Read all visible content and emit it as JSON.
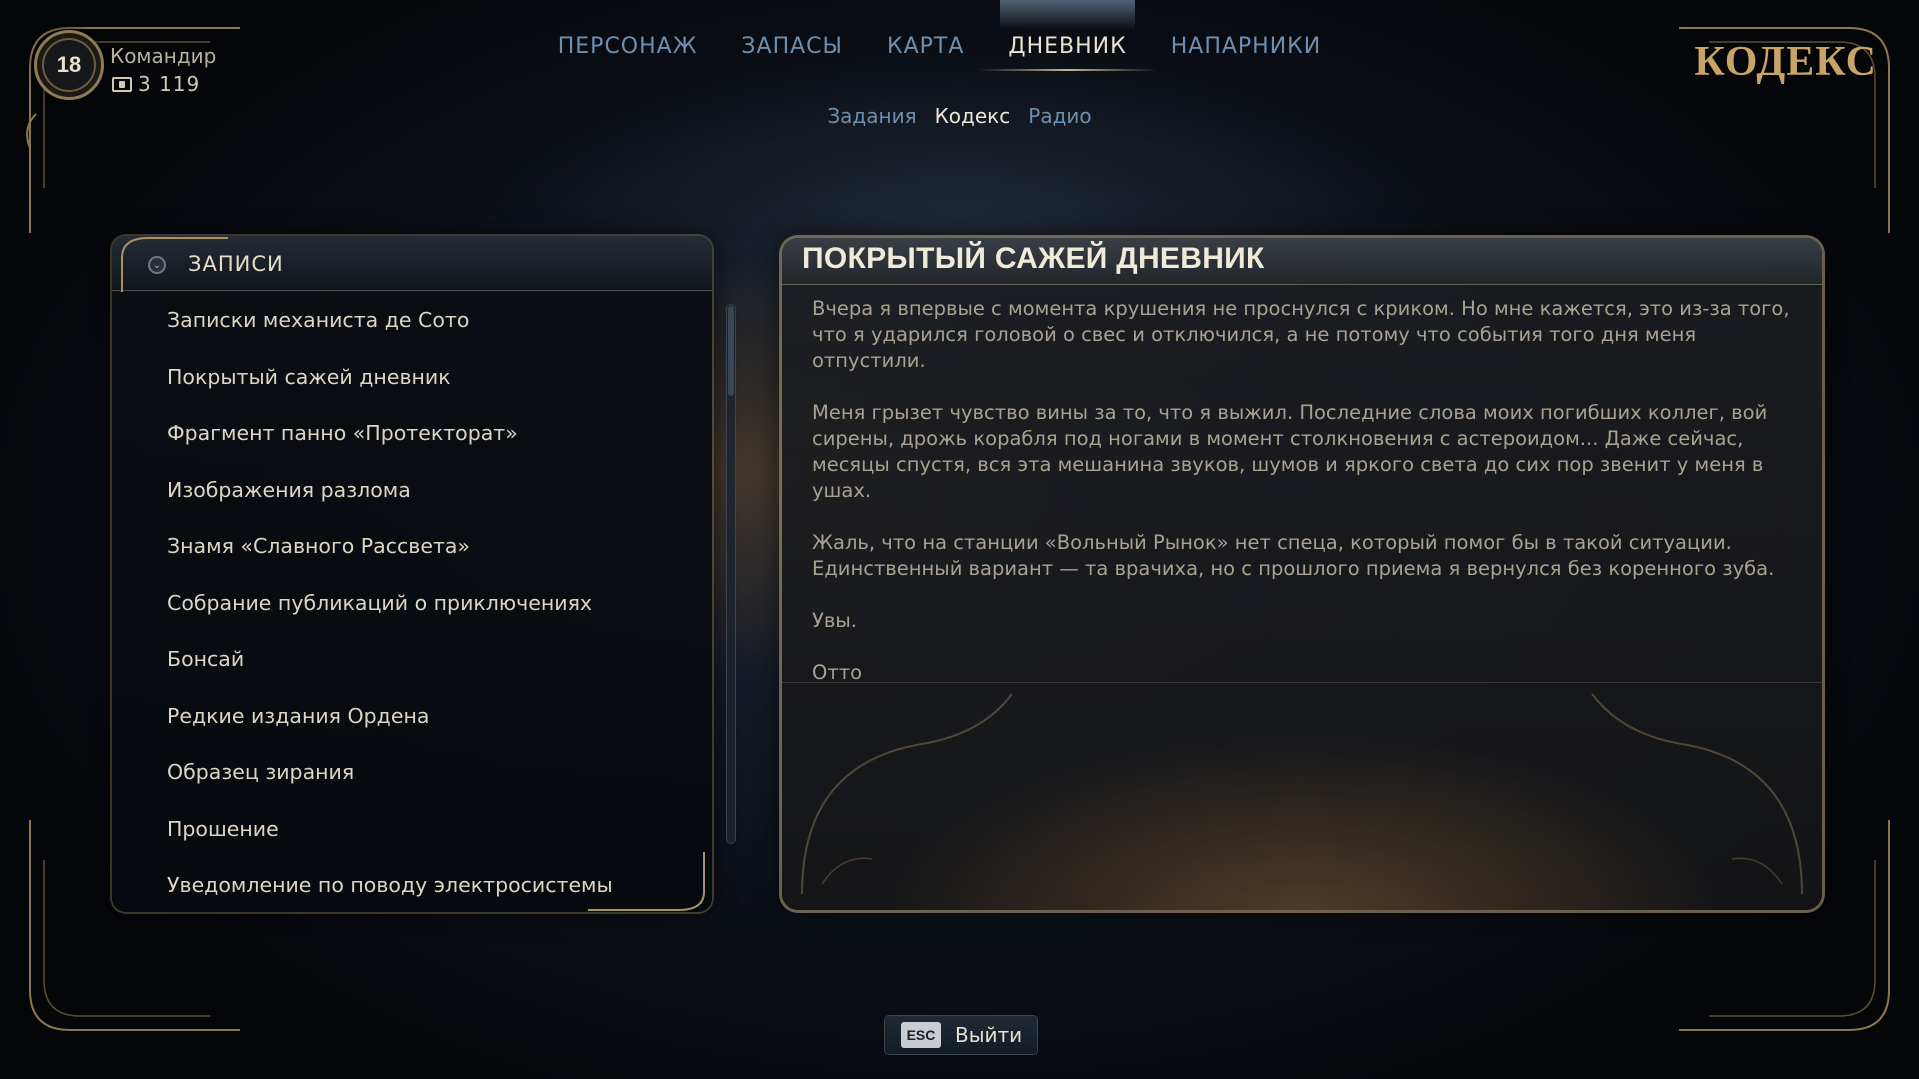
{
  "player": {
    "level": "18",
    "name": "Командир",
    "currency": "3 119"
  },
  "nav": {
    "tabs": [
      {
        "label": "ПЕРСОНАЖ"
      },
      {
        "label": "ЗАПАСЫ"
      },
      {
        "label": "КАРТА"
      },
      {
        "label": "ДНЕВНИК"
      },
      {
        "label": "НАПАРНИКИ"
      }
    ],
    "active_tab": "ДНЕВНИК",
    "sub_tabs": [
      {
        "label": "Задания"
      },
      {
        "label": "Кодекс"
      },
      {
        "label": "Радио"
      }
    ],
    "active_sub_tab": "Кодекс"
  },
  "page_title": "КОДЕКС",
  "list": {
    "header": "ЗАПИСИ",
    "items": [
      {
        "label": "Записки механиста де Сото"
      },
      {
        "label": "Покрытый сажей дневник"
      },
      {
        "label": "Фрагмент панно «Протекторат»"
      },
      {
        "label": "Изображения разлома"
      },
      {
        "label": "Знамя «Славного Рассвета»"
      },
      {
        "label": "Собрание публикаций о приключениях"
      },
      {
        "label": "Бонсай"
      },
      {
        "label": "Редкие издания Ордена"
      },
      {
        "label": "Образец зирания"
      },
      {
        "label": "Прошение"
      },
      {
        "label": "Уведомление по поводу электросистемы"
      }
    ]
  },
  "detail": {
    "title": "ПОКРЫТЫЙ САЖЕЙ ДНЕВНИК",
    "paragraphs": [
      "Вчера я впервые с момента крушения не проснулся с криком. Но мне кажется, это из-за того, что я ударился головой о свес и отключился, а не потому что события того дня меня отпустили.",
      "Меня грызет чувство вины за то, что я выжил. Последние слова моих погибших коллег, вой сирены, дрожь корабля под ногами в момент столкновения с астероидом... Даже сейчас, месяцы спустя, вся эта мешанина звуков, шумов и яркого света до сих пор звенит у меня в ушах.",
      "Жаль, что на станции «Вольный Рынок» нет спеца, который помог бы в такой ситуации. Единственный вариант — та врачиха, но с прошлого приема я вернулся без коренного зуба.",
      "Увы.",
      "Отто"
    ]
  },
  "footer": {
    "esc_key": "ESC",
    "exit_label": "Выйти"
  },
  "colors": {
    "accent_gold": "#c8a468",
    "nav_inactive": "#6f8fb0",
    "text_light": "#e9e3d3"
  }
}
